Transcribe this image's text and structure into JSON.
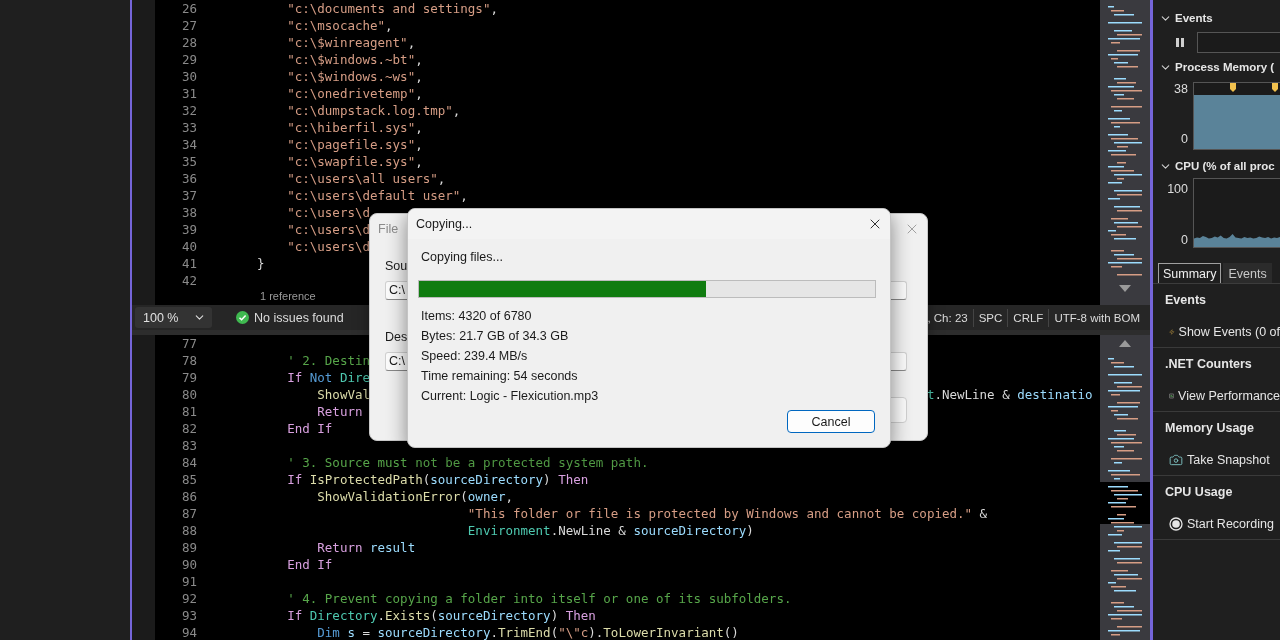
{
  "editor": {
    "top_pane": {
      "lines": [
        {
          "number": "26",
          "parts": [
            {
              "tokens": [
                {
                  "kind": "string",
                  "text": "        \"c:\\documents and settings\""
                },
                {
                  "kind": "plain",
                  "text": ","
                }
              ]
            }
          ]
        },
        {
          "number": "27",
          "parts": [
            {
              "tokens": [
                {
                  "kind": "string",
                  "text": "        \"c:\\msocache\""
                },
                {
                  "kind": "plain",
                  "text": ","
                }
              ]
            }
          ]
        },
        {
          "number": "28",
          "parts": [
            {
              "tokens": [
                {
                  "kind": "string",
                  "text": "        \"c:\\$winreagent\""
                },
                {
                  "kind": "plain",
                  "text": ","
                }
              ]
            }
          ]
        },
        {
          "number": "29",
          "parts": [
            {
              "tokens": [
                {
                  "kind": "string",
                  "text": "        \"c:\\$windows.~bt\""
                },
                {
                  "kind": "plain",
                  "text": ","
                }
              ]
            }
          ]
        },
        {
          "number": "30",
          "parts": [
            {
              "tokens": [
                {
                  "kind": "string",
                  "text": "        \"c:\\$windows.~ws\""
                },
                {
                  "kind": "plain",
                  "text": ","
                }
              ]
            }
          ]
        },
        {
          "number": "31",
          "parts": [
            {
              "tokens": [
                {
                  "kind": "string",
                  "text": "        \"c:\\onedrivetemp\""
                },
                {
                  "kind": "plain",
                  "text": ","
                }
              ]
            }
          ]
        },
        {
          "number": "32",
          "parts": [
            {
              "tokens": [
                {
                  "kind": "string",
                  "text": "        \"c:\\dumpstack.log.tmp\""
                },
                {
                  "kind": "plain",
                  "text": ","
                }
              ]
            }
          ]
        },
        {
          "number": "33",
          "parts": [
            {
              "tokens": [
                {
                  "kind": "string",
                  "text": "        \"c:\\hiberfil.sys\""
                },
                {
                  "kind": "plain",
                  "text": ","
                }
              ]
            }
          ]
        },
        {
          "number": "34",
          "parts": [
            {
              "tokens": [
                {
                  "kind": "string",
                  "text": "        \"c:\\pagefile.sys\""
                },
                {
                  "kind": "plain",
                  "text": ","
                }
              ]
            }
          ]
        },
        {
          "number": "35",
          "parts": [
            {
              "tokens": [
                {
                  "kind": "string",
                  "text": "        \"c:\\swapfile.sys\""
                },
                {
                  "kind": "plain",
                  "text": ","
                }
              ]
            }
          ]
        },
        {
          "number": "36",
          "parts": [
            {
              "tokens": [
                {
                  "kind": "string",
                  "text": "        \"c:\\users\\all users\""
                },
                {
                  "kind": "plain",
                  "text": ","
                }
              ]
            }
          ]
        },
        {
          "number": "37",
          "parts": [
            {
              "tokens": [
                {
                  "kind": "string",
                  "text": "        \"c:\\users\\default user\""
                },
                {
                  "kind": "plain",
                  "text": ","
                }
              ]
            }
          ]
        },
        {
          "number": "38",
          "parts": [
            {
              "tokens": [
                {
                  "kind": "string",
                  "text": "        \"c:\\users\\d"
                }
              ]
            }
          ]
        },
        {
          "number": "39",
          "parts": [
            {
              "tokens": [
                {
                  "kind": "string",
                  "text": "        \"c:\\users\\d"
                }
              ]
            }
          ]
        },
        {
          "number": "40",
          "parts": [
            {
              "tokens": [
                {
                  "kind": "string",
                  "text": "        \"c:\\users\\d"
                }
              ]
            }
          ]
        },
        {
          "number": "41",
          "parts": [
            {
              "tokens": [
                {
                  "kind": "plain",
                  "text": "    }"
                }
              ]
            }
          ]
        },
        {
          "number": "42"
        }
      ],
      "codelens": "1 reference"
    },
    "status_bar": {
      "zoom": "100 %",
      "issues": "No issues found",
      "items": [
        ", Ch: 23",
        "SPC",
        "CRLF",
        "UTF-8 with BOM"
      ]
    },
    "bottom_pane": {
      "lines": [
        {
          "number": "77"
        },
        {
          "number": "78",
          "parts": [
            {
              "tokens": [
                {
                  "kind": "comment",
                  "text": "        ' 2. Destin"
                }
              ]
            }
          ]
        },
        {
          "number": "79",
          "parts": [
            {
              "tokens": [
                {
                  "kind": "control",
                  "text": "        If "
                },
                {
                  "kind": "keyword",
                  "text": "Not "
                },
                {
                  "kind": "type",
                  "text": "Dire"
                }
              ]
            }
          ]
        },
        {
          "number": "80",
          "parts": [
            {
              "tokens": [
                {
                  "kind": "func",
                  "text": "            ShowVal"
                }
              ]
            },
            {
              "tokens": [
                {
                  "kind": "type",
                  "text": "                                                                          t"
                },
                {
                  "kind": "plain",
                  "text": ".NewLine & "
                },
                {
                  "kind": "ident",
                  "text": "destinatio"
                }
              ]
            }
          ]
        },
        {
          "number": "81",
          "parts": [
            {
              "tokens": [
                {
                  "kind": "control",
                  "text": "            Return"
                }
              ]
            }
          ]
        },
        {
          "number": "82",
          "parts": [
            {
              "tokens": [
                {
                  "kind": "control",
                  "text": "        End If"
                }
              ]
            }
          ]
        },
        {
          "number": "83"
        },
        {
          "number": "84",
          "parts": [
            {
              "tokens": [
                {
                  "kind": "comment",
                  "text": "        ' 3. Source must not be a protected system path."
                }
              ]
            }
          ]
        },
        {
          "number": "85",
          "parts": [
            {
              "tokens": [
                {
                  "kind": "control",
                  "text": "        If "
                },
                {
                  "kind": "func",
                  "text": "IsProtectedPath"
                },
                {
                  "kind": "plain",
                  "text": "("
                },
                {
                  "kind": "ident",
                  "text": "sourceDirectory"
                },
                {
                  "kind": "plain",
                  "text": ") "
                },
                {
                  "kind": "control",
                  "text": "Then"
                }
              ]
            }
          ]
        },
        {
          "number": "86",
          "parts": [
            {
              "tokens": [
                {
                  "kind": "func",
                  "text": "            ShowValidationError"
                },
                {
                  "kind": "plain",
                  "text": "("
                },
                {
                  "kind": "ident",
                  "text": "owner"
                },
                {
                  "kind": "plain",
                  "text": ","
                }
              ]
            }
          ]
        },
        {
          "number": "87",
          "parts": [
            {
              "tokens": [
                {
                  "kind": "string",
                  "text": "                                \"This folder or file is protected by Windows and cannot be copied.\""
                },
                {
                  "kind": "plain",
                  "text": " &"
                }
              ]
            }
          ]
        },
        {
          "number": "88",
          "parts": [
            {
              "tokens": [
                {
                  "kind": "type",
                  "text": "                                Environment"
                },
                {
                  "kind": "plain",
                  "text": ".NewLine & "
                },
                {
                  "kind": "ident",
                  "text": "sourceDirectory"
                },
                {
                  "kind": "plain",
                  "text": ")"
                }
              ]
            }
          ]
        },
        {
          "number": "89",
          "parts": [
            {
              "tokens": [
                {
                  "kind": "control",
                  "text": "            Return "
                },
                {
                  "kind": "ident",
                  "text": "result"
                }
              ]
            }
          ]
        },
        {
          "number": "90",
          "parts": [
            {
              "tokens": [
                {
                  "kind": "control",
                  "text": "        End If"
                }
              ]
            }
          ]
        },
        {
          "number": "91"
        },
        {
          "number": "92",
          "parts": [
            {
              "tokens": [
                {
                  "kind": "comment",
                  "text": "        ' 4. Prevent copying a folder into itself or one of its subfolders."
                }
              ]
            }
          ]
        },
        {
          "number": "93",
          "parts": [
            {
              "tokens": [
                {
                  "kind": "control",
                  "text": "        If "
                },
                {
                  "kind": "type",
                  "text": "Directory"
                },
                {
                  "kind": "plain",
                  "text": "."
                },
                {
                  "kind": "func",
                  "text": "Exists"
                },
                {
                  "kind": "plain",
                  "text": "("
                },
                {
                  "kind": "ident",
                  "text": "sourceDirectory"
                },
                {
                  "kind": "plain",
                  "text": ") "
                },
                {
                  "kind": "control",
                  "text": "Then"
                }
              ]
            }
          ]
        },
        {
          "number": "94",
          "parts": [
            {
              "tokens": [
                {
                  "kind": "keyword",
                  "text": "            Dim "
                },
                {
                  "kind": "ident",
                  "text": "s"
                },
                {
                  "kind": "plain",
                  "text": " = "
                },
                {
                  "kind": "ident",
                  "text": "sourceDirectory"
                },
                {
                  "kind": "plain",
                  "text": "."
                },
                {
                  "kind": "func",
                  "text": "TrimEnd"
                },
                {
                  "kind": "plain",
                  "text": "("
                },
                {
                  "kind": "string",
                  "text": "\"\\\"c"
                },
                {
                  "kind": "plain",
                  "text": ")."
                },
                {
                  "kind": "func",
                  "text": "ToLowerInvariant"
                },
                {
                  "kind": "plain",
                  "text": "()"
                }
              ]
            }
          ]
        }
      ]
    }
  },
  "diagnostics": {
    "events_track": {
      "label": "Events",
      "expanded": true
    },
    "graphs": [
      {
        "kind": "memory",
        "label": "Process Memory (",
        "expanded": true,
        "axis_labels": [
          "38",
          "0"
        ]
      },
      {
        "kind": "cpu",
        "label": "CPU (% of all proc",
        "expanded": true,
        "axis_labels": [
          "100",
          "0"
        ]
      }
    ],
    "tabs": [
      {
        "label": "Summary",
        "selected": true
      },
      {
        "label": "Events",
        "selected": false
      }
    ],
    "sections": [
      {
        "kind": "events",
        "title": "Events",
        "action": "Show Events (0 of"
      },
      {
        "kind": "counters",
        "title": ".NET Counters",
        "action": "View Performance"
      },
      {
        "kind": "snapshot",
        "title": "Memory Usage",
        "action": "Take Snapshot"
      },
      {
        "kind": "recording",
        "title": "CPU Usage",
        "action": "Start Recording"
      }
    ]
  },
  "back_dialog": {
    "title": "File",
    "source_label": "Sou",
    "source_value": "C:\\",
    "destination_label": "Des",
    "destination_value": "C:\\"
  },
  "copy_dialog": {
    "title": "Copying...",
    "heading": "Copying files...",
    "progress": {
      "level": 0.63
    },
    "stats": [
      "Items: 4320 of 6780",
      "Bytes: 21.7 GB of 34.3 GB",
      "Speed: 239.4 MB/s",
      "Time remaining: 54 seconds",
      "Current: Logic - Flexicution.mp3"
    ],
    "button": "Cancel"
  }
}
